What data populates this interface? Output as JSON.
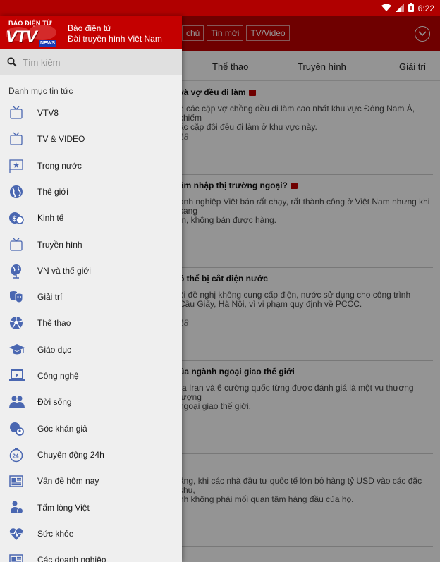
{
  "status_bar": {
    "time": "6:22"
  },
  "header": {
    "nav_items": [
      "chủ",
      "Tin mới",
      "TV/Video"
    ]
  },
  "category_tabs": [
    "Thể thao",
    "Truyền hình",
    "Giải trí"
  ],
  "articles": [
    {
      "title": "và vợ đều đi làm",
      "has_video": true,
      "summary": "ệ các cặp vợ chồng đều đi làm cao nhất khu vực Đông Nam Á, chiếm\nác cặp đôi đều đi làm ở khu vực này.",
      "date": "18"
    },
    {
      "title": "âm nhập thị trường ngoại?",
      "has_video": true,
      "summary": "anh nghiệp Việt bán rất chạy, rất thành công ở Việt Nam nhưng khi sang\nm, không bán được hàng.",
      "date": ""
    },
    {
      "title": "ó thể bị cắt điện nước",
      "has_video": false,
      "summary": "ội đề nghị không cung cấp điện, nước sử dụng cho công trình\nCầu Giấy, Hà Nội, vì vi phạm quy định về PCCC.",
      "date": "18"
    },
    {
      "title": "ủa ngành ngoại giao thế giới",
      "has_video": false,
      "summary": "ra Iran và 6 cường quốc từng được đánh giá là một vụ thương lượng\nngoại giao thế giới.",
      "date": ""
    },
    {
      "title": "",
      "has_video": false,
      "summary": "ăng, khi các nhà đầu tư quốc tế lớn bỏ hàng tỷ USD vào các đặc khu,\nnh không phải mối quan tâm hàng đầu của họ.",
      "date": ""
    }
  ],
  "drawer": {
    "logo": {
      "top_text": "BÁO ĐIỆN TỬ",
      "main_text": "VTV",
      "badge_text": "NEWS"
    },
    "brand_line1": "Báo điện tử",
    "brand_line2": "Đài truyền hình Việt Nam",
    "search": {
      "placeholder": "Tìm kiếm"
    },
    "section_title": "Danh mục tin tức",
    "menu": [
      {
        "label": "VTV8",
        "icon": "tv-icon"
      },
      {
        "label": "TV & VIDEO",
        "icon": "tv-icon"
      },
      {
        "label": "Trong nước",
        "icon": "flag-icon"
      },
      {
        "label": "Thế giới",
        "icon": "globe-icon"
      },
      {
        "label": "Kinh tế",
        "icon": "money-icon"
      },
      {
        "label": "Truyền hình",
        "icon": "tv-icon"
      },
      {
        "label": "VN và thế giới",
        "icon": "globe-stand-icon"
      },
      {
        "label": "Giải trí",
        "icon": "masks-icon"
      },
      {
        "label": "Thể thao",
        "icon": "soccer-ball-icon"
      },
      {
        "label": "Giáo dục",
        "icon": "graduation-cap-icon"
      },
      {
        "label": "Công nghệ",
        "icon": "laptop-icon"
      },
      {
        "label": "Đời sống",
        "icon": "people-icon"
      },
      {
        "label": "Góc khán giả",
        "icon": "audience-icon"
      },
      {
        "label": "Chuyển động 24h",
        "icon": "timer-24-icon"
      },
      {
        "label": "Vấn đề hôm nay",
        "icon": "newspaper-icon"
      },
      {
        "label": "Tấm lòng Việt",
        "icon": "charity-icon"
      },
      {
        "label": "Sức khỏe",
        "icon": "heart-pulse-icon"
      },
      {
        "label": "Các doanh nghiệp",
        "icon": "newspaper-icon"
      }
    ]
  },
  "colors": {
    "brand_red": "#c40000",
    "icon_blue": "#4a67b1",
    "drawer_bg": "#efefef"
  }
}
